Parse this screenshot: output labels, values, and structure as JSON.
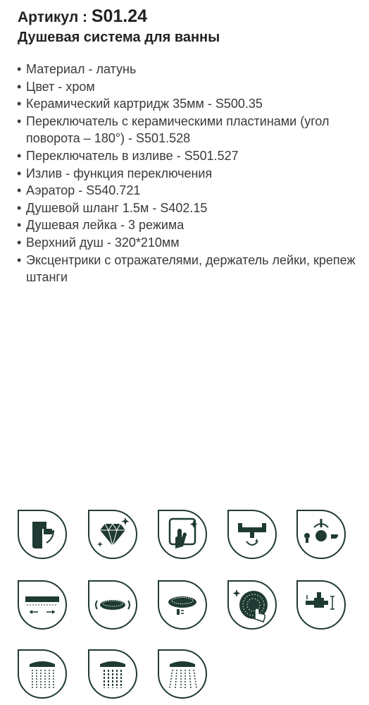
{
  "header": {
    "article_label": "Артикул : ",
    "article_code": "S01.24",
    "title": "Душевая система для ванны"
  },
  "specs": [
    "Материал - латунь",
    "Цвет - хром",
    "Керамический картридж 35мм - S500.35",
    "Переключатель с керамическими пластинами (угол поворота – 180°) - S501.528",
    "Переключатель в изливе - S501.527",
    "Излив - функция переключения",
    "Аэратор - S540.721",
    "Душевой шланг 1.5м - S402.15",
    "Душевая лейка - 3 режима",
    "Верхний душ - 320*210мм",
    "Эксцентрики с отражателями, держатель лейки, крепеж штанги"
  ],
  "colors": {
    "badge": "#1f3a33",
    "text": "#2b2b2b"
  },
  "icons": [
    "ceramic-cartridge-icon",
    "diamond-quality-icon",
    "easy-clean-icon",
    "two-handle-mixer-icon",
    "diverter-switch-icon",
    "rain-shower-rect-icon",
    "round-shower-adjustable-icon",
    "round-shower-head-icon",
    "anti-limescale-nozzles-icon",
    "wall-mount-icon",
    "spray-mode-1-icon",
    "spray-mode-2-icon",
    "spray-mode-3-icon"
  ]
}
